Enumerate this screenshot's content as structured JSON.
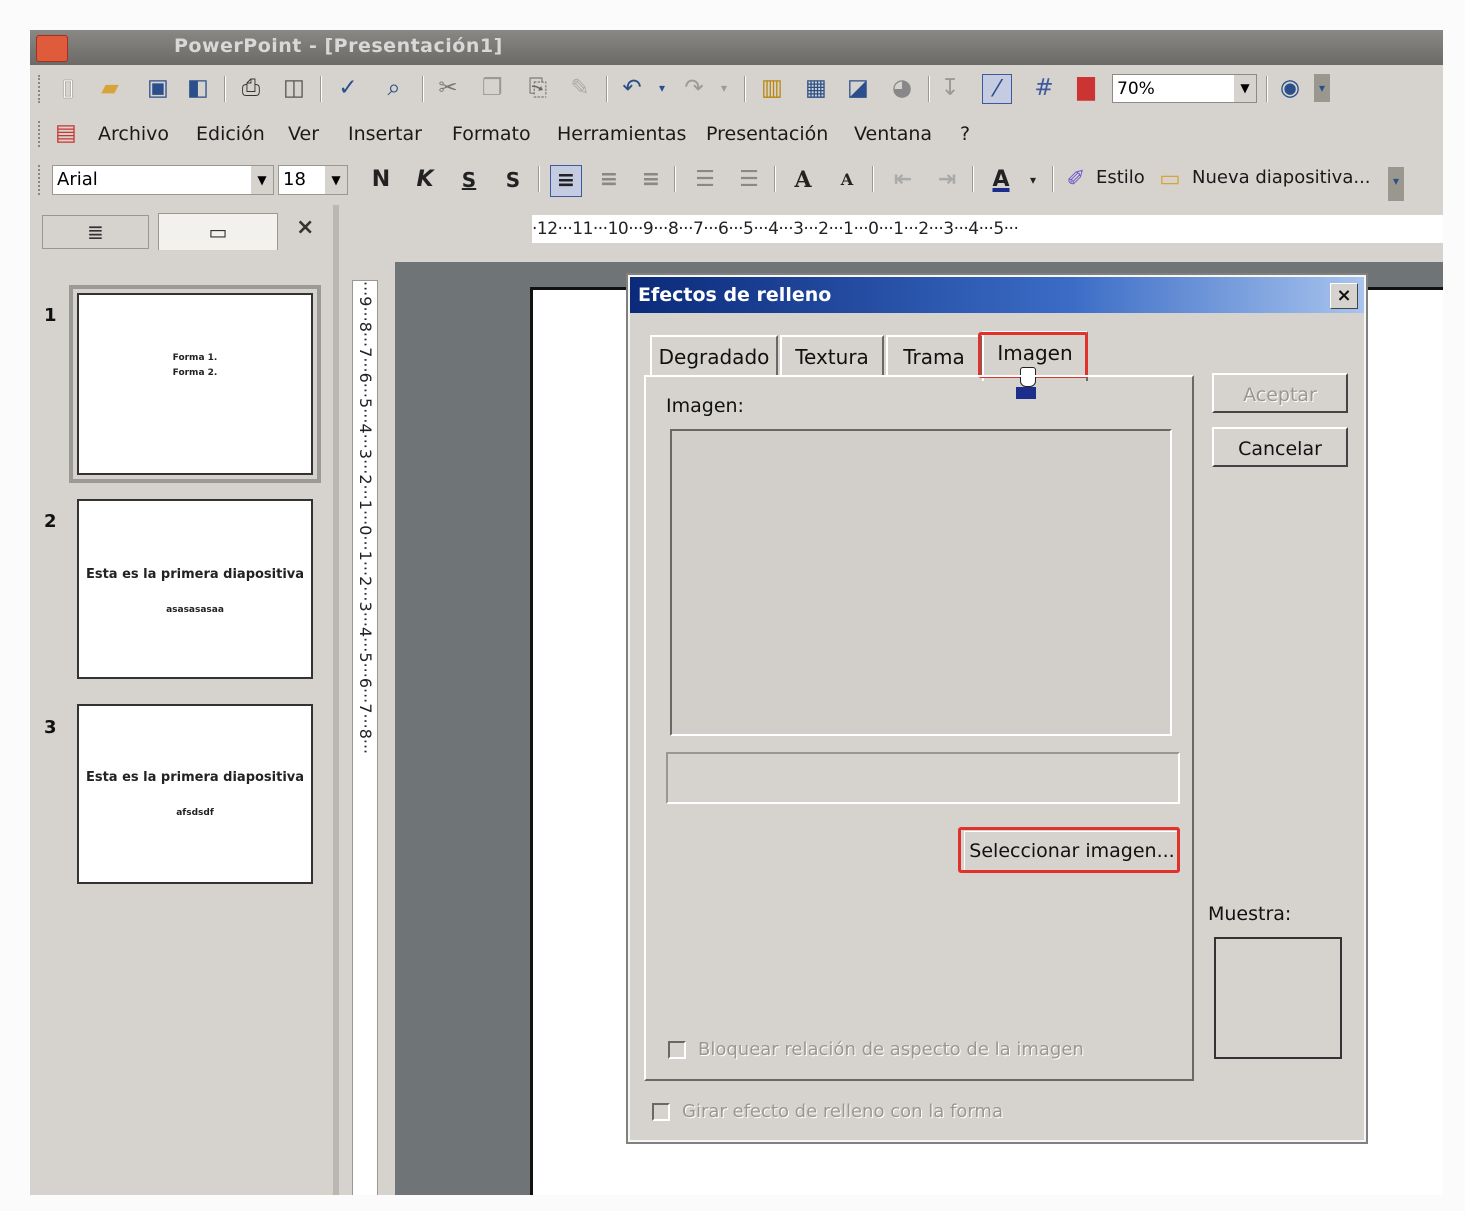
{
  "window": {
    "title": "PowerPoint - [Presentación1]"
  },
  "toolbar": {
    "zoom": "70%",
    "icons": [
      "new-icon",
      "open-icon",
      "save-icon",
      "permission-icon",
      "print-icon",
      "print-preview-icon",
      "spelling-icon",
      "research-icon",
      "cut-icon",
      "copy-icon",
      "paste-icon",
      "format-painter-icon",
      "undo-icon",
      "redo-icon",
      "insert-chart-icon",
      "insert-table-icon",
      "tables-borders-icon",
      "color-grayscale-icon",
      "expand-all-icon",
      "show-formatting-icon",
      "grid-icon",
      "color-icon",
      "help-icon"
    ]
  },
  "menu": {
    "items": [
      "Archivo",
      "Edición",
      "Ver",
      "Insertar",
      "Formato",
      "Herramientas",
      "Presentación",
      "Ventana",
      "?"
    ]
  },
  "formatting": {
    "font": "Arial",
    "size": "18",
    "bold": "N",
    "italic": "K",
    "underline": "S",
    "shadow": "S",
    "style_label": "Estilo",
    "new_slide_label": "Nueva diapositiva..."
  },
  "panel": {
    "close": "×",
    "slides": [
      {
        "num": "1",
        "line1": "Forma 1.",
        "line2": "Forma 2."
      },
      {
        "num": "2",
        "line1": "Esta es la primera diapositiva",
        "line2": "asasasasaa"
      },
      {
        "num": "3",
        "line1": "Esta es la primera diapositiva",
        "line2": "afsdsdf"
      }
    ]
  },
  "rulers": {
    "horizontal": "·12···11···10···9···8···7···6···5···4···3···2···1···0···1···2···3···4···5···",
    "vertical": "···9···8···7···6···5···4···3···2···1···0···1···2···3···4···5···6···7···8···"
  },
  "dialog": {
    "title": "Efectos de relleno",
    "close": "×",
    "tabs": [
      "Degradado",
      "Textura",
      "Trama",
      "Imagen"
    ],
    "image_label": "Imagen:",
    "select_button": "Seleccionar imagen...",
    "accept": "Aceptar",
    "cancel": "Cancelar",
    "sample_label": "Muestra:",
    "lock_aspect": "Bloquear relación de aspecto de la imagen",
    "rotate_fill": "Girar efecto de relleno con la forma"
  },
  "highlight_color": "#e0322b"
}
